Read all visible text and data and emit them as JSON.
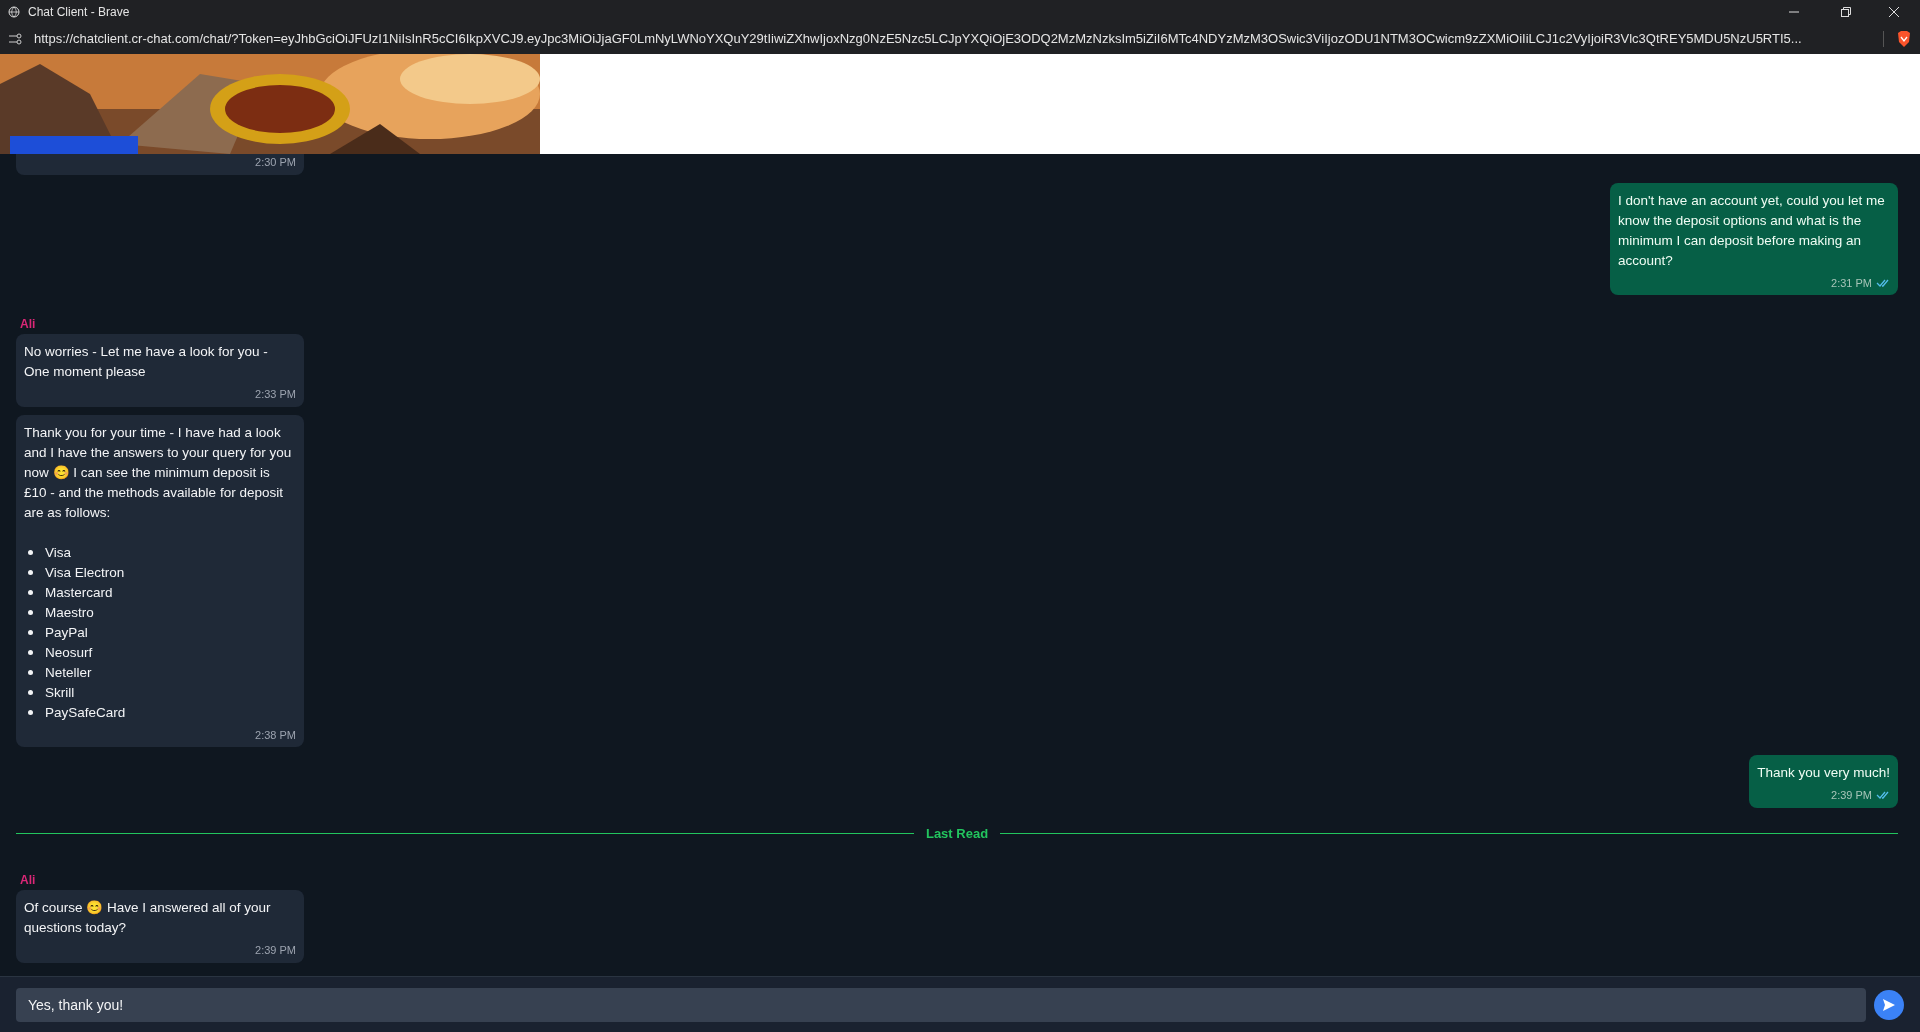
{
  "window": {
    "title": "Chat Client - Brave"
  },
  "address_bar": {
    "url": "https://chatclient.cr-chat.com/chat/?Token=eyJhbGciOiJFUzI1NiIsInR5cCI6IkpXVCJ9.eyJpc3MiOiJjaGF0LmNyLWNoYXQuY29tIiwiZXhwIjoxNzg0NzE5Nzc5LCJpYXQiOjE3ODQ2MzMzNzksIm5iZiI6MTc4NDYzMzM3OSwic3ViIjozODU1NTM3OCwicm9zZXMiOiIiLCJ1c2VyIjoiR3Vlc3QtREY5MDU5NzU5RTI5..."
  },
  "messages": [
    {
      "kind": "partial",
      "time": "2:30 PM"
    },
    {
      "kind": "sent",
      "text": "I don't have an account yet, could you let me know the deposit options and what is the minimum I can deposit before making an account?",
      "time": "2:31 PM",
      "read": true
    },
    {
      "kind": "received",
      "sender": "Ali",
      "text": "No worries - Let me have a look for you - One moment please",
      "time": "2:33 PM"
    },
    {
      "kind": "received",
      "text": "Thank you for your time - I have had a look and I have the answers to your query for you now 😊 I can see the minimum deposit is £10 - and the methods available for deposit are as follows:",
      "items": [
        "Visa",
        "Visa Electron",
        "Mastercard",
        "Maestro",
        "PayPal",
        "Neosurf",
        "Neteller",
        "Skrill",
        "PaySafeCard"
      ],
      "time": "2:38 PM"
    },
    {
      "kind": "sent",
      "text": "Thank you very much!",
      "time": "2:39 PM",
      "read": true
    },
    {
      "kind": "divider",
      "text": "Last Read"
    },
    {
      "kind": "received",
      "sender": "Ali",
      "text": "Of course 😊 Have I answered all of your questions today?",
      "time": "2:39 PM"
    }
  ],
  "composer": {
    "value": "Yes, thank you!"
  }
}
